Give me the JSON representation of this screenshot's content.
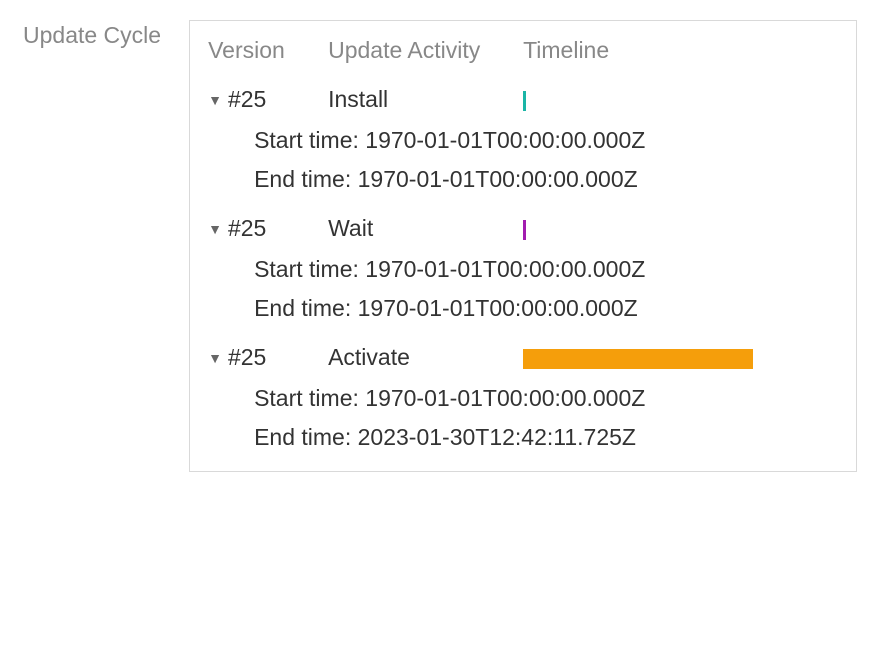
{
  "side_label": "Update Cycle",
  "headers": {
    "version": "Version",
    "activity": "Update Activity",
    "timeline": "Timeline"
  },
  "labels": {
    "start": "Start time:",
    "end": "End time:"
  },
  "rows": [
    {
      "version": "#25",
      "activity": "Install",
      "bar_class": "install",
      "start": "1970-01-01T00:00:00.000Z",
      "end": "1970-01-01T00:00:00.000Z"
    },
    {
      "version": "#25",
      "activity": "Wait",
      "bar_class": "wait",
      "start": "1970-01-01T00:00:00.000Z",
      "end": "1970-01-01T00:00:00.000Z"
    },
    {
      "version": "#25",
      "activity": "Activate",
      "bar_class": "activate",
      "start": "1970-01-01T00:00:00.000Z",
      "end": "2023-01-30T12:42:11.725Z"
    }
  ]
}
